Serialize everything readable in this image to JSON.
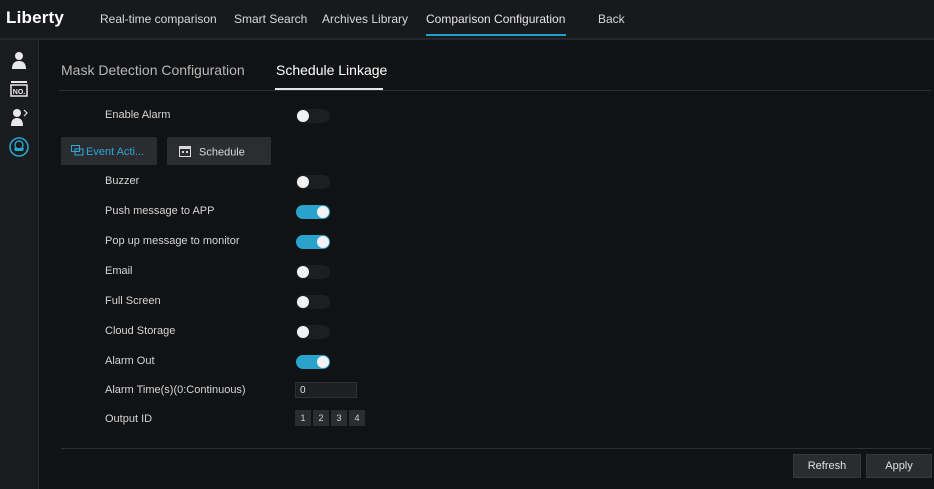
{
  "header": {
    "logo": "Liberty",
    "nav": [
      {
        "label": "Real-time comparison"
      },
      {
        "label": "Smart Search"
      },
      {
        "label": "Archives Library"
      },
      {
        "label": "Comparison Configuration"
      },
      {
        "label": "Back"
      }
    ],
    "active_nav": "Comparison Configuration"
  },
  "sidebar": {
    "icons": [
      "person-icon",
      "id-number-icon",
      "person-compare-icon",
      "face-mask-icon"
    ],
    "active_icon": "face-mask-icon"
  },
  "subtabs": [
    {
      "label": "Mask Detection Configuration"
    },
    {
      "label": "Schedule Linkage"
    }
  ],
  "active_subtab": "Schedule Linkage",
  "enable_alarm": {
    "label": "Enable Alarm",
    "on": false
  },
  "inner_tabs": [
    {
      "label": "Event Acti...",
      "icon": "event-action-icon"
    },
    {
      "label": "Schedule",
      "icon": "calendar-icon"
    }
  ],
  "active_inner_tab": "Event Acti...",
  "actions": [
    {
      "label": "Buzzer",
      "on": false
    },
    {
      "label": "Push message to APP",
      "on": true
    },
    {
      "label": "Pop up message to monitor",
      "on": true
    },
    {
      "label": "Email",
      "on": false
    },
    {
      "label": "Full Screen",
      "on": false
    },
    {
      "label": "Cloud Storage",
      "on": false
    },
    {
      "label": "Alarm Out",
      "on": true
    }
  ],
  "alarm_time": {
    "label": "Alarm Time(s)(0:Continuous)",
    "value": "0"
  },
  "output_id": {
    "label": "Output ID",
    "options": [
      "1",
      "2",
      "3",
      "4"
    ]
  },
  "buttons": {
    "refresh": "Refresh",
    "apply": "Apply"
  },
  "colors": {
    "accent": "#2aa3cc",
    "background": "#111214",
    "topbar": "#17191c"
  }
}
